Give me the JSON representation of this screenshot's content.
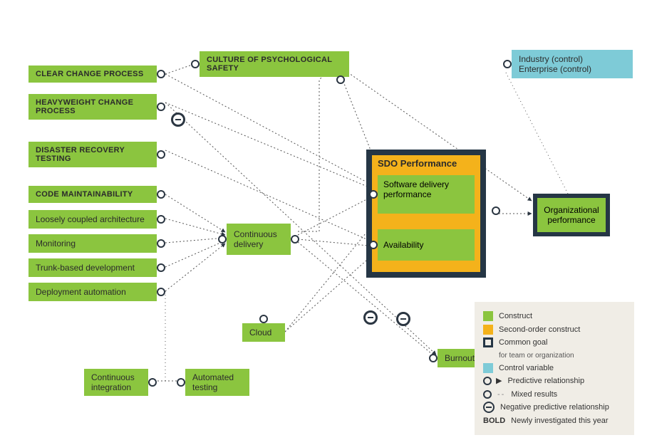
{
  "nodes": {
    "clear_change": "CLEAR CHANGE PROCESS",
    "heavy_change": "HEAVYWEIGHT CHANGE PROCESS",
    "disaster": "DISASTER RECOVERY TESTING",
    "code_maint": "CODE MAINTAINABILITY",
    "loosely": "Loosely coupled architecture",
    "monitoring": "Monitoring",
    "trunk": "Trunk-based development",
    "deploy_auto": "Deployment automation",
    "psych_safety": "CULTURE OF PSYCHOLOGICAL SAFETY",
    "cont_delivery": "Continuous delivery",
    "cloud": "Cloud",
    "cont_integration": "Continuous integration",
    "auto_testing": "Automated testing",
    "burnout": "Burnout",
    "sdo_title": "SDO Performance",
    "sdo_sdp": "Software delivery performance",
    "sdo_avail": "Availability",
    "org_perf": "Organizational performance",
    "ctrl_industry": "Industry (control)",
    "ctrl_enterprise": "Enterprise (control)"
  },
  "legend": {
    "construct": "Construct",
    "second_order": "Second-order construct",
    "common_goal": "Common goal",
    "common_goal_sub": "for team or organization",
    "control_var": "Control variable",
    "predictive": "Predictive relationship",
    "mixed": "Mixed results",
    "negative": "Negative predictive relationship",
    "bold": "BOLD",
    "bold_label": "Newly investigated this year"
  },
  "chart_data": {
    "type": "diagram",
    "title": "DORA research model",
    "constructs_bold_new": [
      "CLEAR CHANGE PROCESS",
      "HEAVYWEIGHT CHANGE PROCESS",
      "DISASTER RECOVERY TESTING",
      "CODE MAINTAINABILITY",
      "CULTURE OF PSYCHOLOGICAL SAFETY"
    ],
    "constructs": [
      "Loosely coupled architecture",
      "Monitoring",
      "Trunk-based development",
      "Deployment automation",
      "Continuous delivery",
      "Cloud",
      "Continuous integration",
      "Automated testing",
      "Burnout",
      "Software delivery performance",
      "Availability",
      "Organizational performance"
    ],
    "second_order_constructs": [
      "SDO Performance"
    ],
    "control_variables": [
      "Industry (control)",
      "Enterprise (control)"
    ],
    "common_goals": [
      "SDO Performance",
      "Organizational performance"
    ],
    "edges": [
      {
        "from": "Clear change process",
        "to": "Culture of psychological safety",
        "type": "predictive"
      },
      {
        "from": "Clear change process",
        "to": "Software delivery performance",
        "type": "predictive"
      },
      {
        "from": "Heavyweight change process",
        "to": "Software delivery performance",
        "type": "negative"
      },
      {
        "from": "Heavyweight change process",
        "to": "Burnout",
        "type": "negative"
      },
      {
        "from": "Disaster recovery testing",
        "to": "Availability",
        "type": "predictive"
      },
      {
        "from": "Code maintainability",
        "to": "Continuous delivery",
        "type": "predictive"
      },
      {
        "from": "Loosely coupled architecture",
        "to": "Continuous delivery",
        "type": "predictive"
      },
      {
        "from": "Monitoring",
        "to": "Continuous delivery",
        "type": "predictive"
      },
      {
        "from": "Trunk-based development",
        "to": "Continuous delivery",
        "type": "predictive"
      },
      {
        "from": "Deployment automation",
        "to": "Continuous delivery",
        "type": "predictive"
      },
      {
        "from": "Deployment automation",
        "to": "Continuous integration",
        "type": "mixed"
      },
      {
        "from": "Cloud",
        "to": "Software delivery performance",
        "type": "predictive"
      },
      {
        "from": "Cloud",
        "to": "Availability",
        "type": "predictive"
      },
      {
        "from": "Continuous delivery",
        "to": "Culture of psychological safety",
        "type": "predictive"
      },
      {
        "from": "Continuous delivery",
        "to": "Software delivery performance",
        "type": "predictive"
      },
      {
        "from": "Continuous delivery",
        "to": "Availability",
        "type": "predictive"
      },
      {
        "from": "Continuous delivery",
        "to": "Burnout",
        "type": "negative"
      },
      {
        "from": "Culture of psychological safety",
        "to": "Software delivery performance",
        "type": "predictive"
      },
      {
        "from": "Culture of psychological safety",
        "to": "Organizational performance",
        "type": "predictive"
      },
      {
        "from": "Automated testing",
        "to": "Continuous integration",
        "type": "predictive"
      },
      {
        "from": "SDO Performance",
        "to": "Organizational performance",
        "type": "predictive"
      },
      {
        "from": "Industry (control)",
        "to": "Organizational performance",
        "type": "mixed"
      },
      {
        "from": "Enterprise (control)",
        "to": "Organizational performance",
        "type": "mixed"
      }
    ]
  }
}
